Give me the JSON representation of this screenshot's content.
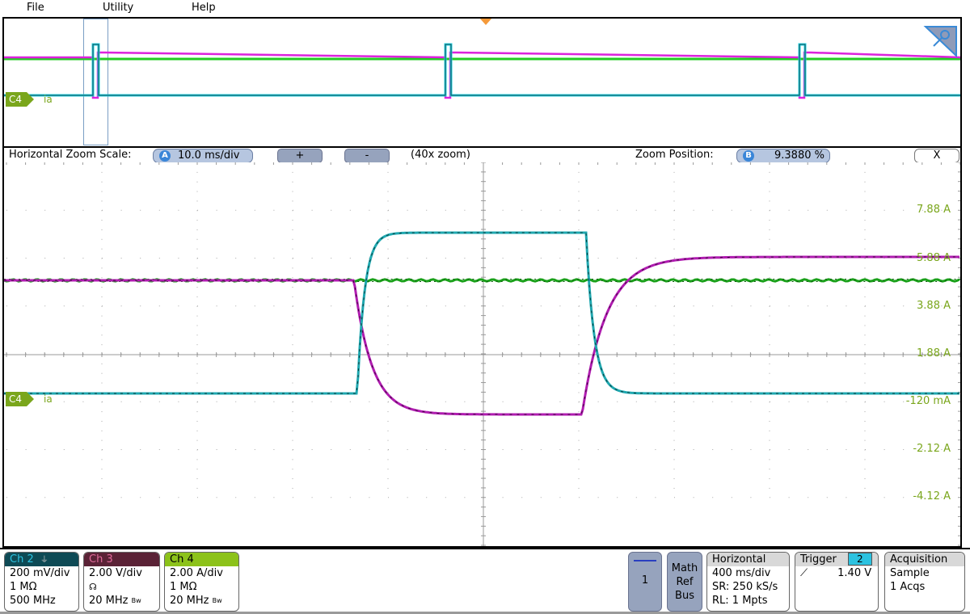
{
  "menu": {
    "items": [
      {
        "label": "File"
      },
      {
        "label": "Utility"
      },
      {
        "label": "Help"
      }
    ]
  },
  "overview": {
    "channel_marker": "C4",
    "trace_label": "ia",
    "icons": {
      "trigger_marker": "trigger-position-marker",
      "zoom_corner": "zoom-handle-icon"
    }
  },
  "zoom_bar": {
    "scale_label": "Horizontal Zoom Scale:",
    "scale_badge": "A",
    "scale_value": "10.0 ms/div",
    "plus_label": "+",
    "minus_label": "-",
    "zoom_factor": "(40x zoom)",
    "position_label": "Zoom Position:",
    "position_badge": "B",
    "position_value": "9.3880 %",
    "close_label": "X"
  },
  "main_view": {
    "channel_marker": "C4",
    "trace_label": "ia",
    "y_axis_labels": [
      "7.88 A",
      "5.88 A",
      "3.88 A",
      "1.88 A",
      "-120 mA",
      "-2.12 A",
      "-4.12 A"
    ],
    "trace_colors": {
      "ch2": "#1fa8b0",
      "ch3": "#b01cb0",
      "ch4": "#1aa01a"
    }
  },
  "status_bar": {
    "ch2": {
      "title": "Ch 2",
      "icon": "ground-arrow-icon",
      "scale": "200 mV/div",
      "impedance": "1 MΩ",
      "bandwidth": "500 MHz",
      "header_color": "#0e4a55",
      "title_color": "#2cc2e0"
    },
    "ch3": {
      "title": "Ch 3",
      "scale": "2.00 V/div",
      "probe_icon": "probe-icon",
      "bandwidth": "20 MHz",
      "bw_suffix": "Bw",
      "header_color": "#5a2236",
      "title_color": "#e06a9a"
    },
    "ch4": {
      "title": "Ch 4",
      "scale": "2.00 A/div",
      "impedance": "1 MΩ",
      "bandwidth": "20 MHz",
      "bw_suffix": "Bw",
      "header_color": "#8cc21a",
      "title_color": "#000000"
    },
    "waveform_btn": {
      "label": "1"
    },
    "math_ref_bus": {
      "line1": "Math",
      "line2": "Ref",
      "line3": "Bus"
    },
    "horizontal": {
      "title": "Horizontal",
      "scale": "400 ms/div",
      "sample_rate": "SR: 250 kS/s",
      "record_length": "RL: 1 Mpts"
    },
    "trigger": {
      "title": "Trigger",
      "source": "2",
      "slope_icon": "rising-edge-icon",
      "level": "1.40 V"
    },
    "acquisition": {
      "title": "Acquisition",
      "mode": "Sample",
      "count": "1 Acqs"
    }
  }
}
